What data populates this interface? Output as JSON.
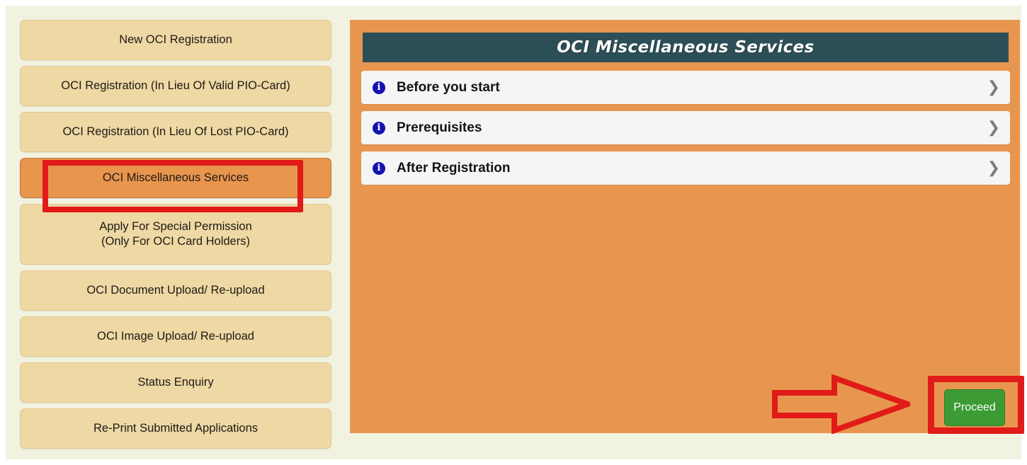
{
  "sidebar": {
    "items": [
      {
        "label": "New OCI Registration",
        "lines": [
          "New OCI Registration"
        ],
        "selected": false
      },
      {
        "label": "OCI Registration (In Lieu Of Valid PIO-Card)",
        "lines": [
          "OCI Registration (In Lieu Of Valid PIO-Card)"
        ],
        "selected": false
      },
      {
        "label": "OCI Registration (In Lieu Of Lost PIO-Card)",
        "lines": [
          "OCI Registration (In Lieu Of Lost PIO-Card)"
        ],
        "selected": false
      },
      {
        "label": "OCI Miscellaneous Services",
        "lines": [
          "OCI Miscellaneous Services"
        ],
        "selected": true
      },
      {
        "label": "Apply For Special Permission (Only For OCI Card Holders)",
        "lines": [
          "Apply For Special Permission",
          "(Only For OCI Card Holders)"
        ],
        "selected": false
      },
      {
        "label": "OCI Document Upload/ Re-upload",
        "lines": [
          "OCI Document Upload/ Re-upload"
        ],
        "selected": false
      },
      {
        "label": "OCI Image Upload/ Re-upload",
        "lines": [
          "OCI Image Upload/ Re-upload"
        ],
        "selected": false
      },
      {
        "label": "Status Enquiry",
        "lines": [
          "Status Enquiry"
        ],
        "selected": false
      },
      {
        "label": "Re-Print Submitted Applications",
        "lines": [
          "Re-Print Submitted Applications"
        ],
        "selected": false
      }
    ]
  },
  "main": {
    "header_title": "OCI Miscellaneous Services",
    "accordion": [
      {
        "icon": "info-icon",
        "icon_glyph": "i",
        "label": "Before you start",
        "chevron": "❯"
      },
      {
        "icon": "info-icon",
        "icon_glyph": "i",
        "label": "Prerequisites",
        "chevron": "❯"
      },
      {
        "icon": "info-icon",
        "icon_glyph": "i",
        "label": "After Registration",
        "chevron": "❯"
      }
    ],
    "proceed_label": "Proceed"
  },
  "annotations": {
    "highlight_color": "#e01b18",
    "arrow_direction": "right",
    "sidebar_highlight_target": "OCI Miscellaneous Services",
    "proceed_highlight_target": "Proceed"
  },
  "colors": {
    "page_background": "#f2f2e1",
    "sidebar_button": "#eed8a4",
    "sidebar_button_selected": "#e8954e",
    "panel": "#e8964f",
    "header_bar": "#2c4f57",
    "accordion_row": "#f5f5f5",
    "info_icon": "#1212b4",
    "proceed_button": "#3c9b35",
    "annotation_red": "#e01b18"
  }
}
